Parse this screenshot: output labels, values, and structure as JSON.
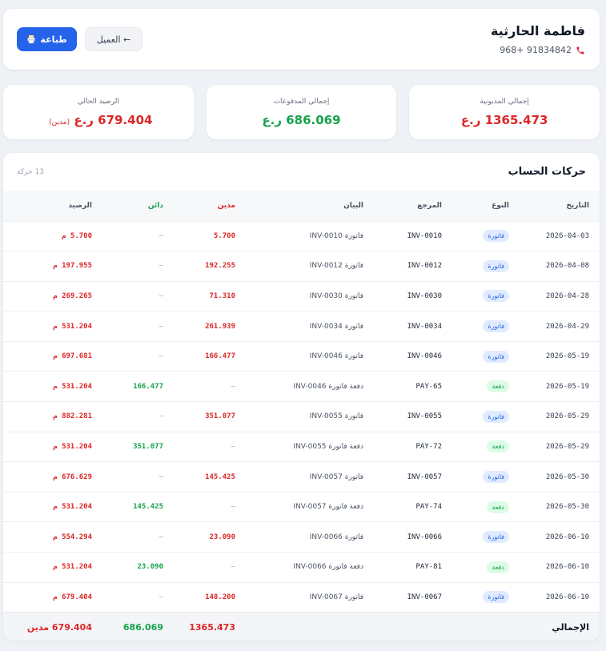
{
  "header": {
    "customer_name": "فاطمة الحارثية",
    "phone": "968+ 91834842",
    "print_label": "طباعة",
    "back_label": "← العميل"
  },
  "stats": {
    "total_debt": {
      "label": "إجمالي المديونية",
      "value": "1365.473 ر.ع"
    },
    "total_payments": {
      "label": "إجمالي المدفوعات",
      "value": "686.069 ر.ع"
    },
    "current_balance": {
      "label": "الرصيد الحالي",
      "value": "679.404 ر.ع",
      "note": "(مدين)"
    }
  },
  "table": {
    "title": "حركات الحساب",
    "count": "13 حركة",
    "columns": {
      "date": "التاريخ",
      "type": "النوع",
      "ref": "المرجع",
      "desc": "البيان",
      "debit": "مدين",
      "credit": "دائن",
      "balance": "الرصيد"
    },
    "rows": [
      {
        "date": "2026-04-03",
        "type": "فاتورة",
        "kind": "invoice",
        "ref": "INV-0010",
        "desc": "فاتورة INV-0010",
        "debit": "5.700",
        "credit": "–",
        "balance": "5.700 م"
      },
      {
        "date": "2026-04-08",
        "type": "فاتورة",
        "kind": "invoice",
        "ref": "INV-0012",
        "desc": "فاتورة INV-0012",
        "debit": "192.255",
        "credit": "–",
        "balance": "197.955 م"
      },
      {
        "date": "2026-04-28",
        "type": "فاتورة",
        "kind": "invoice",
        "ref": "INV-0030",
        "desc": "فاتورة INV-0030",
        "debit": "71.310",
        "credit": "–",
        "balance": "269.265 م"
      },
      {
        "date": "2026-04-29",
        "type": "فاتورة",
        "kind": "invoice",
        "ref": "INV-0034",
        "desc": "فاتورة INV-0034",
        "debit": "261.939",
        "credit": "–",
        "balance": "531.204 م"
      },
      {
        "date": "2026-05-19",
        "type": "فاتورة",
        "kind": "invoice",
        "ref": "INV-0046",
        "desc": "فاتورة INV-0046",
        "debit": "166.477",
        "credit": "–",
        "balance": "697.681 م"
      },
      {
        "date": "2026-05-19",
        "type": "دفعة",
        "kind": "payment",
        "ref": "PAY-65",
        "desc": "دفعة فاتورة INV-0046",
        "debit": "–",
        "credit": "166.477",
        "balance": "531.204 م"
      },
      {
        "date": "2026-05-29",
        "type": "فاتورة",
        "kind": "invoice",
        "ref": "INV-0055",
        "desc": "فاتورة INV-0055",
        "debit": "351.077",
        "credit": "–",
        "balance": "882.281 م"
      },
      {
        "date": "2026-05-29",
        "type": "دفعة",
        "kind": "payment",
        "ref": "PAY-72",
        "desc": "دفعة فاتورة INV-0055",
        "debit": "–",
        "credit": "351.077",
        "balance": "531.204 م"
      },
      {
        "date": "2026-05-30",
        "type": "فاتورة",
        "kind": "invoice",
        "ref": "INV-0057",
        "desc": "فاتورة INV-0057",
        "debit": "145.425",
        "credit": "–",
        "balance": "676.629 م"
      },
      {
        "date": "2026-05-30",
        "type": "دفعة",
        "kind": "payment",
        "ref": "PAY-74",
        "desc": "دفعة فاتورة INV-0057",
        "debit": "–",
        "credit": "145.425",
        "balance": "531.204 م"
      },
      {
        "date": "2026-06-10",
        "type": "فاتورة",
        "kind": "invoice",
        "ref": "INV-0066",
        "desc": "فاتورة INV-0066",
        "debit": "23.090",
        "credit": "–",
        "balance": "554.294 م"
      },
      {
        "date": "2026-06-10",
        "type": "دفعة",
        "kind": "payment",
        "ref": "PAY-81",
        "desc": "دفعة فاتورة INV-0066",
        "debit": "–",
        "credit": "23.090",
        "balance": "531.204 م"
      },
      {
        "date": "2026-06-10",
        "type": "فاتورة",
        "kind": "invoice",
        "ref": "INV-0067",
        "desc": "فاتورة INV-0067",
        "debit": "148.200",
        "credit": "–",
        "balance": "679.404 م"
      }
    ],
    "totals": {
      "label": "الإجمالي",
      "debit": "1365.473",
      "credit": "686.069",
      "balance": "679.404 مدين"
    }
  },
  "colors": {
    "accent": "#2563eb",
    "debit": "#dc2626",
    "credit": "#16a34a",
    "background": "#eef1f5"
  },
  "icons": {
    "phone": "phone-icon",
    "print": "printer-icon"
  }
}
